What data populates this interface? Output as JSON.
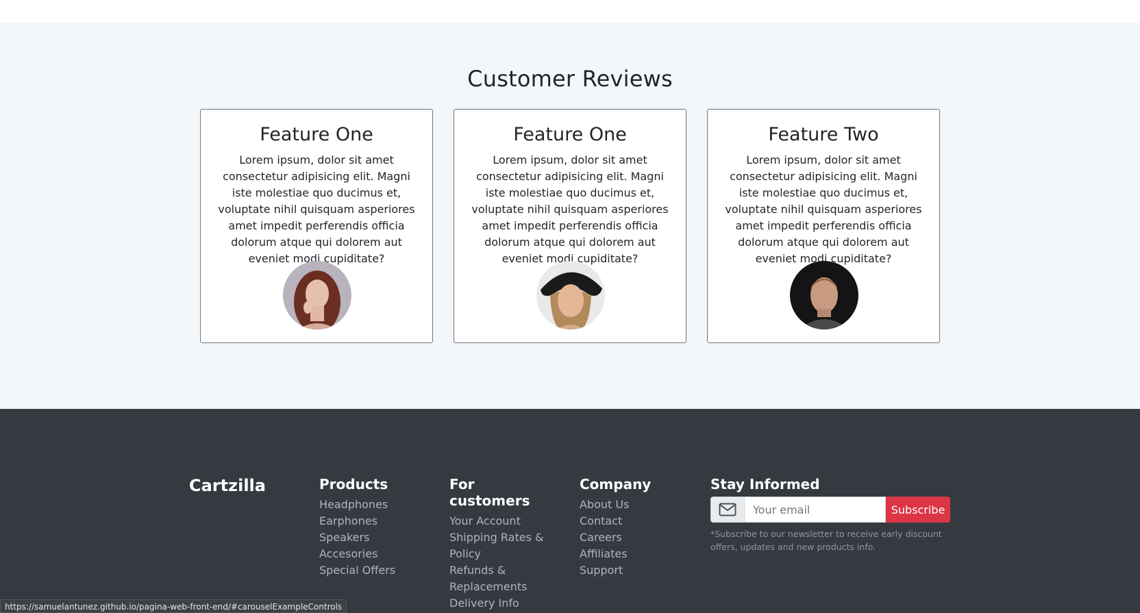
{
  "reviews": {
    "title": "Customer Reviews",
    "cards": [
      {
        "title": "Feature One",
        "text": "Lorem ipsum, dolor sit amet consectetur adipisicing elit. Magni iste molestiae quo ducimus et, voluptate nihil quisquam asperiores amet impedit perferendis officia dolorum atque qui dolorem aut eveniet modi cupiditate?",
        "avatar": "woman-portrait-red-hair"
      },
      {
        "title": "Feature One",
        "text": "Lorem ipsum, dolor sit amet consectetur adipisicing elit. Magni iste molestiae quo ducimus et, voluptate nihil quisquam asperiores amet impedit perferendis officia dolorum atque qui dolorem aut eveniet modi cupiditate?",
        "avatar": "woman-portrait-hat"
      },
      {
        "title": "Feature Two",
        "text": "Lorem ipsum, dolor sit amet consectetur adipisicing elit. Magni iste molestiae quo ducimus et, voluptate nihil quisquam asperiores amet impedit perferendis officia dolorum atque qui dolorem aut eveniet modi cupiditate?",
        "avatar": "man-portrait"
      }
    ]
  },
  "footer": {
    "brand": "Cartzilla",
    "products": {
      "title": "Products",
      "links": [
        "Headphones",
        "Earphones",
        "Speakers",
        "Accesories",
        "Special Offers"
      ]
    },
    "customers": {
      "title": "For customers",
      "links": [
        "Your Account",
        "Shipping Rates & Policy",
        "Refunds & Replacements",
        "Delivery Info"
      ]
    },
    "company": {
      "title": "Company",
      "links": [
        "About Us",
        "Contact",
        "Careers",
        "Affiliates",
        "Support"
      ]
    },
    "newsletter": {
      "title": "Stay Informed",
      "placeholder": "Your email",
      "button": "Subscribe",
      "note": "*Subscribe to our newsletter to receive early discount offers, updates and new products info.",
      "icon": "envelope-icon"
    }
  },
  "status_bar": {
    "url": "https://samuelantunez.github.io/pagina-web-front-end/#carouselExampleControls"
  },
  "colors": {
    "section_bg": "#f4f7fa",
    "footer_bg": "#343a40",
    "accent": "#dc3545",
    "link": "#adb5bd"
  }
}
